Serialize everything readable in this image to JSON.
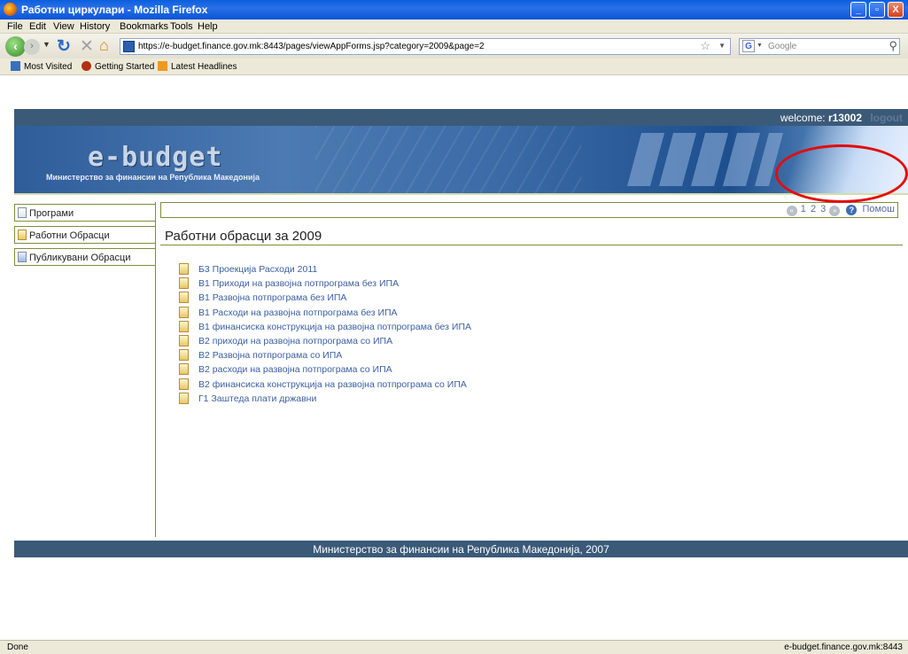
{
  "window": {
    "title": "Работни циркулари - Mozilla Firefox",
    "minimize": "_",
    "maximize": "▫",
    "close": "X"
  },
  "menu": [
    "File",
    "Edit",
    "View",
    "History",
    "Bookmarks",
    "Tools",
    "Help"
  ],
  "toolbar": {
    "url": "https://e-budget.finance.gov.mk:8443/pages/viewAppForms.jsp?category=2009&page=2",
    "search_placeholder": "Google",
    "search_engine_icon": "G"
  },
  "bookmarks": [
    "Most Visited",
    "Getting Started",
    "Latest Headlines"
  ],
  "page": {
    "welcome_prefix": "welcome: ",
    "username": "r13002",
    "logout": "logout",
    "logo": "e-budget",
    "ministry_subtitle": "Министерство за финансии на Република Македонија",
    "sidebar": [
      {
        "label": "Програми"
      },
      {
        "label": "Работни Обрасци"
      },
      {
        "label": "Публикувани Обрасци"
      }
    ],
    "pager": {
      "pages": [
        "1",
        "2",
        "3"
      ],
      "help": "Помош"
    },
    "heading": "Работни обрасци за 2009",
    "forms": [
      "Б3 Проекција Расходи 2011",
      "В1 Приходи на развојна потпрограма без ИПА",
      "В1 Развојна потпрограма без ИПА",
      "В1 Расходи на развојна потпрограма без ИПА",
      "В1 финансиска конструкција на развојна потпрограма без ИПА",
      "В2 приходи на развојна потпрограма со ИПА",
      "В2 Развојна потпрограма со ИПА",
      "В2 расходи на развојна потпрограма со ИПА",
      "В2 финансиска конструкција на развојна потпрограма со ИПА",
      "Г1 Заштеда плати државни"
    ],
    "footer": "Министерство за финансии на Република Македонија, 2007"
  },
  "status": {
    "left": "Done",
    "right": "e-budget.finance.gov.mk:8443"
  },
  "colors": {
    "header_band": "#3b5a78",
    "accent_border": "#7f8f3a",
    "annotation_circle": "#e20c0c"
  }
}
